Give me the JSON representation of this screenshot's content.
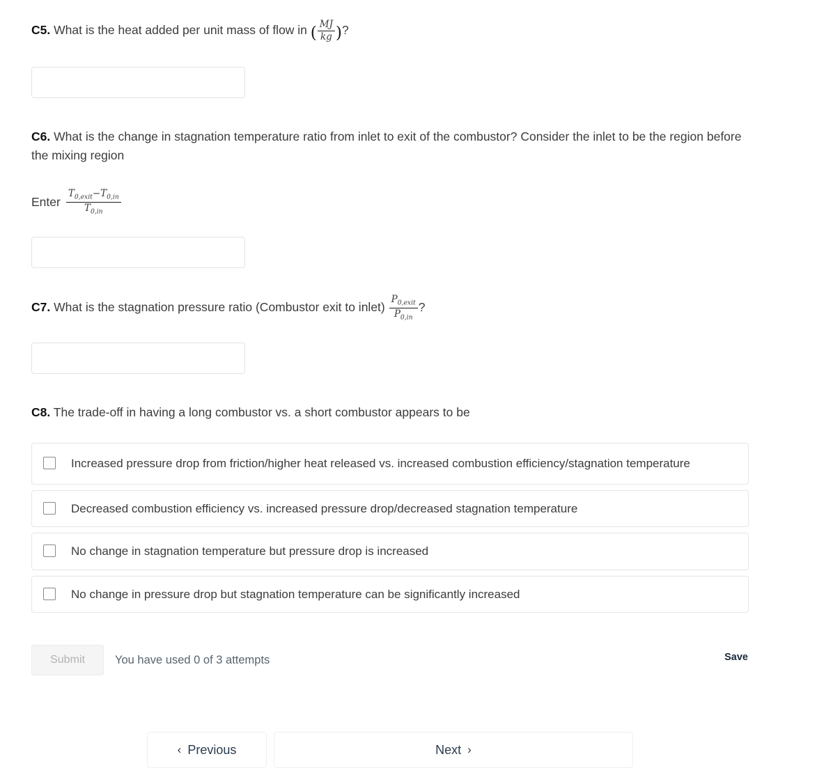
{
  "questions": [
    {
      "label": "C5.",
      "text_before": "What is the heat added per unit mass of flow in",
      "math": {
        "numerator": "MJ",
        "denominator": "kg"
      },
      "text_after": "?",
      "input_value": ""
    },
    {
      "label": "C6.",
      "text": "What is the change in stagnation temperature ratio from inlet to exit of the combustor? Consider the inlet to be the region before the mixing region",
      "enter_label": "Enter",
      "math": {
        "numerator_t_exit": "T",
        "numerator_t_exit_sub": "0,exit",
        "minus": "−",
        "numerator_t_in": "T",
        "numerator_t_in_sub": "0,in",
        "denominator_t": "T",
        "denominator_t_sub": "0,in"
      },
      "input_value": ""
    },
    {
      "label": "C7.",
      "text_before": "What is the stagnation pressure ratio (Combustor exit to inlet)",
      "math": {
        "numerator_p": "P",
        "numerator_p_sub": "0,exit",
        "denominator_p": "P",
        "denominator_p_sub": "0,in"
      },
      "text_after": "?",
      "input_value": ""
    },
    {
      "label": "C8.",
      "text": "The trade-off in having a long combustor vs. a short combustor appears to be",
      "options": [
        "Increased pressure drop from friction/higher heat released vs. increased combustion efficiency/stagnation temperature",
        "Decreased combustion efficiency vs. increased pressure drop/decreased stagnation temperature",
        "No change in stagnation temperature but pressure drop is increased",
        "No change in pressure drop but stagnation temperature can be significantly increased"
      ]
    }
  ],
  "footer": {
    "submit_label": "Submit",
    "attempts_text": "You have used 0 of 3 attempts",
    "save_label": "Save"
  },
  "navigation": {
    "previous_label": "Previous",
    "previous_chevron": "‹",
    "next_label": "Next",
    "next_chevron": "›"
  }
}
